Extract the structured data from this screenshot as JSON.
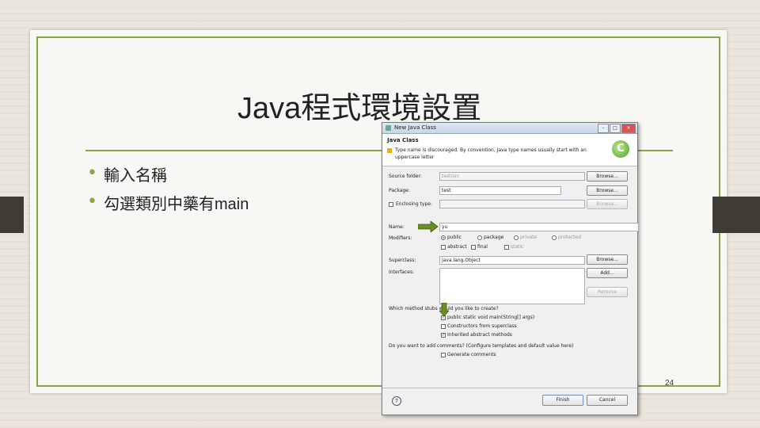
{
  "slide": {
    "title": "Java程式環境設置",
    "bullets": [
      "輸入名稱",
      "勾選類別中藥有main"
    ],
    "page_number": "24",
    "accent_color": "#8da24a"
  },
  "dialog": {
    "window_title": "New Java Class",
    "window_buttons": [
      "minimize-icon",
      "maximize-icon",
      "close-icon"
    ],
    "header_title": "Java Class",
    "header_message": "Type name is discouraged. By convention, Java type names usually start with an uppercase letter",
    "source_folder_label": "Source folder:",
    "source_folder_value": "test/src",
    "package_label": "Package:",
    "package_value": "test",
    "enclosing_type_label": "Enclosing type:",
    "name_label": "Name:",
    "name_value": "yu",
    "modifiers_label": "Modifiers:",
    "modifiers": [
      "public",
      "package",
      "private",
      "protected"
    ],
    "modifiers_selected": "public",
    "modifier_flags": [
      "abstract",
      "final",
      "static"
    ],
    "superclass_label": "Superclass:",
    "superclass_value": "java.lang.Object",
    "interfaces_label": "Interfaces:",
    "browse_label": "Browse...",
    "add_label": "Add...",
    "remove_label": "Remove",
    "stubs_question": "Which method stubs would you like to create?",
    "stubs": [
      {
        "label": "public static void main(String[] args)",
        "checked": true
      },
      {
        "label": "Constructors from superclass",
        "checked": false
      },
      {
        "label": "Inherited abstract methods",
        "checked": true
      }
    ],
    "comments_question": "Do you want to add comments? (Configure templates and default value here)",
    "generate_comments_label": "Generate comments",
    "finish_label": "Finish",
    "cancel_label": "Cancel"
  }
}
